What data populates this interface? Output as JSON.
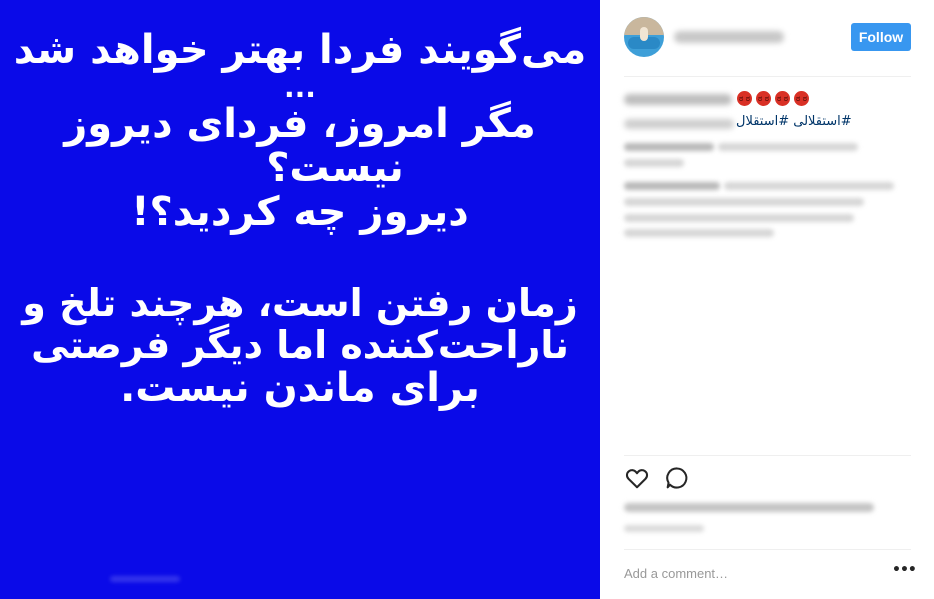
{
  "post_image": {
    "background": "#0a0ae8",
    "text_color": "#ffffff",
    "lines": [
      "می‌گویند فردا بهتر خواهد شد",
      "...",
      "مگر امروز، فردای دیروز",
      "نیست؟",
      "دیروز چه کردید؟!",
      "زمان رفتن است، هرچند تلخ و",
      "ناراحت‌کننده اما دیگر فرصتی",
      "برای ماندن نیست."
    ]
  },
  "header": {
    "follow_label": "Follow",
    "follow_color": "#3897f0"
  },
  "caption": {
    "emoji_icon": "angry-face-icon",
    "emoji_count": 4,
    "hashtags": "#استقلالی #استقلال"
  },
  "actions": {
    "like_icon": "heart-icon",
    "comment_icon": "comment-bubble-icon",
    "more_icon": "more-options-icon"
  },
  "comment_box": {
    "placeholder": "Add a comment…",
    "more_label": "•••"
  }
}
